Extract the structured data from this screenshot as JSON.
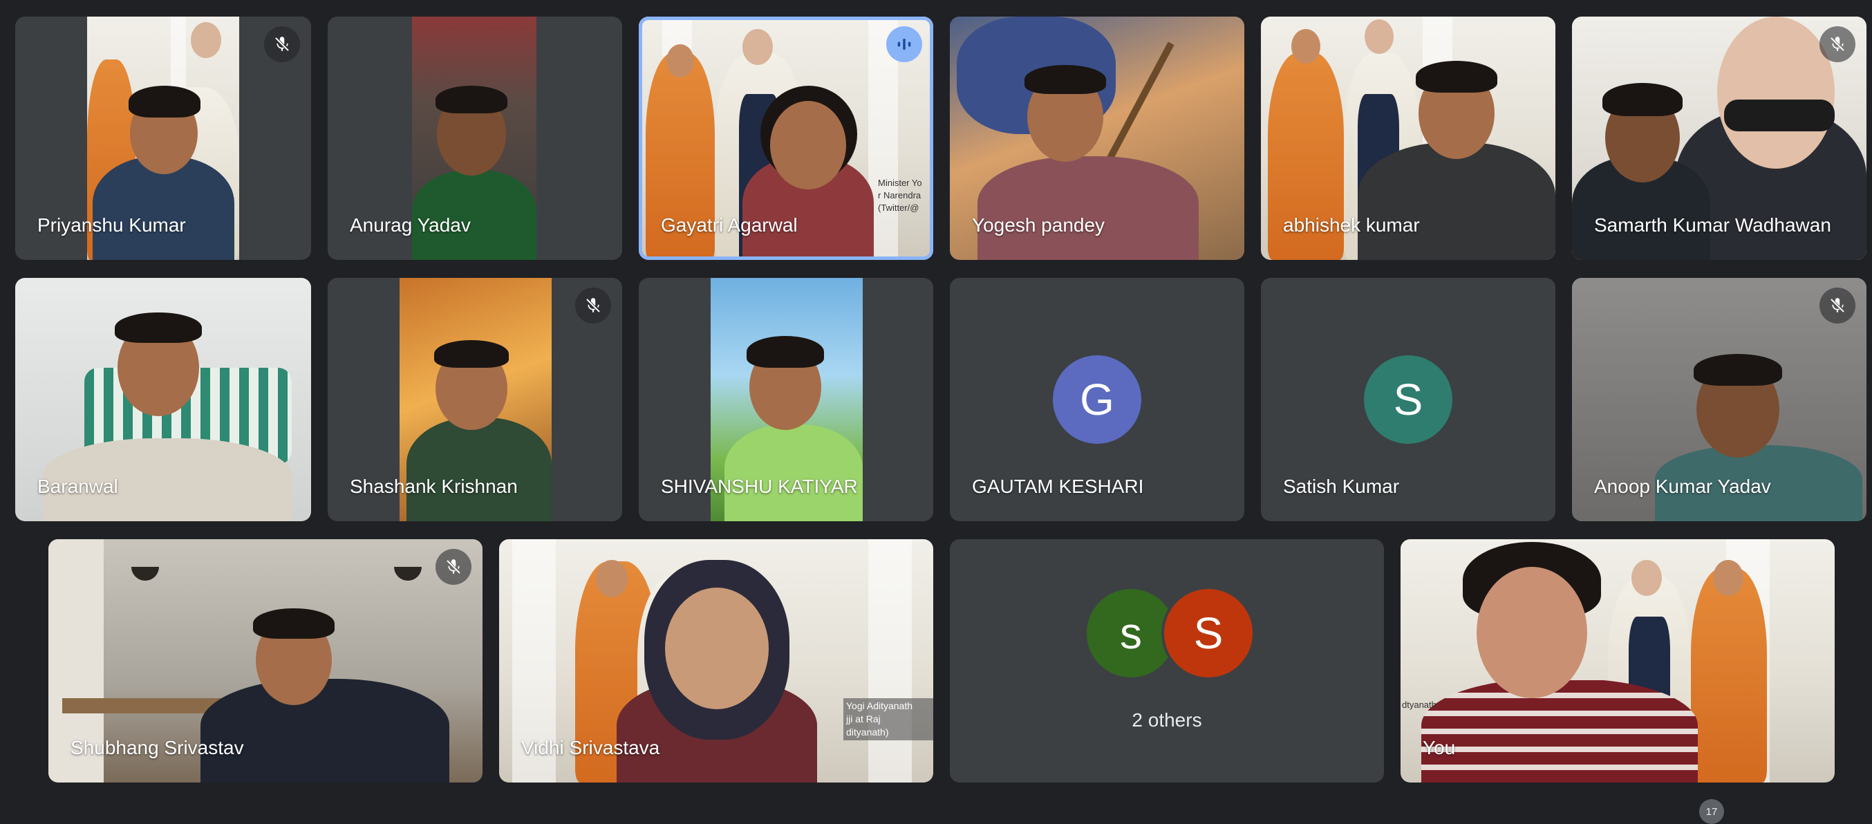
{
  "participants": [
    {
      "name": "Priyanshu Kumar",
      "muted": true
    },
    {
      "name": "Anurag Yadav",
      "muted": false
    },
    {
      "name": "Gayatri Agarwal",
      "muted": false,
      "speaking": true,
      "overlay_text": "Minister Yo\nr Narendra\n(Twitter/@"
    },
    {
      "name": "Yogesh pandey",
      "muted": false
    },
    {
      "name": "abhishek kumar",
      "muted": false
    },
    {
      "name": "Samarth Kumar Wadhawan",
      "muted": true
    },
    {
      "name": "Baranwal",
      "muted": false
    },
    {
      "name": "Shashank Krishnan",
      "muted": true
    },
    {
      "name": "SHIVANSHU KATIYAR",
      "muted": false
    },
    {
      "name": "GAUTAM KESHARI",
      "avatar_letter": "G",
      "avatar_color": "#5c6bc0"
    },
    {
      "name": "Satish Kumar",
      "avatar_letter": "S",
      "avatar_color": "#2e7d6e"
    },
    {
      "name": "Anoop Kumar Yadav",
      "muted": true
    },
    {
      "name": "Shubhang Srivastav",
      "muted": true
    },
    {
      "name": "Vidhi Srivastava",
      "muted": false,
      "overlay_text": "Yogi Adityanath\njji at Raj\ndityanath)"
    },
    {
      "name": "You",
      "muted": false,
      "overlay_text": "dtyanath"
    }
  ],
  "others_tile": {
    "avatars": [
      {
        "letter": "s",
        "color": "#33691e"
      },
      {
        "letter": "S",
        "color": "#bf360c"
      }
    ],
    "label": "2 others"
  },
  "participant_count_badge": "17",
  "colors": {
    "background": "#202124",
    "tile": "#3c4043",
    "active_border": "#8ab4f8"
  },
  "icons": {
    "muted": "mic-off-icon",
    "speaking": "audio-wave-icon"
  }
}
